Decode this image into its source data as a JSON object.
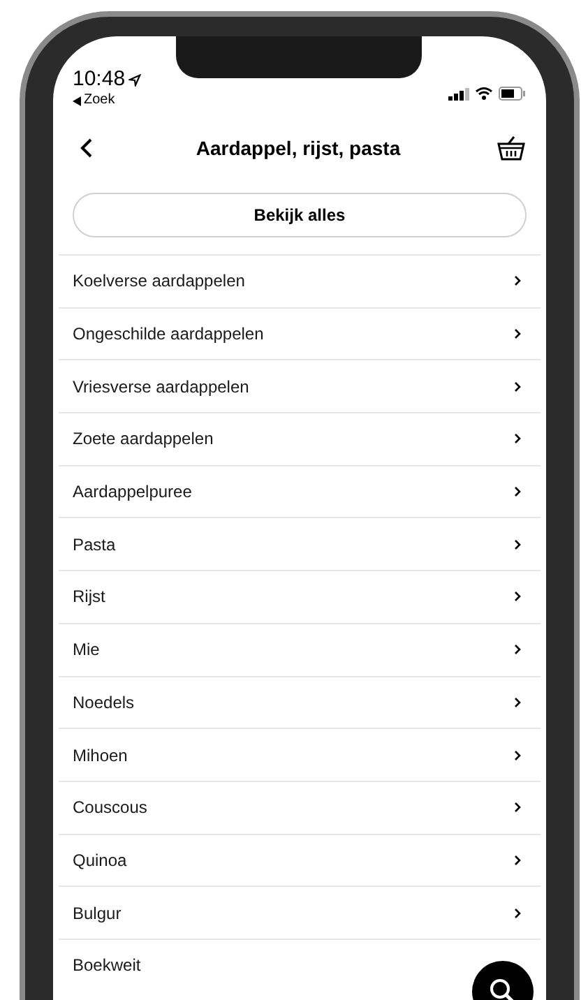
{
  "status_bar": {
    "time": "10:48",
    "back_label": "Zoek"
  },
  "header": {
    "title": "Aardappel, rijst, pasta"
  },
  "view_all_button": {
    "label": "Bekijk alles"
  },
  "categories": [
    {
      "label": "Koelverse aardappelen",
      "chevron": true
    },
    {
      "label": "Ongeschilde aardappelen",
      "chevron": true
    },
    {
      "label": "Vriesverse aardappelen",
      "chevron": true
    },
    {
      "label": "Zoete aardappelen",
      "chevron": true
    },
    {
      "label": "Aardappelpuree",
      "chevron": true
    },
    {
      "label": "Pasta",
      "chevron": true
    },
    {
      "label": "Rijst",
      "chevron": true
    },
    {
      "label": "Mie",
      "chevron": true
    },
    {
      "label": "Noedels",
      "chevron": true
    },
    {
      "label": "Mihoen",
      "chevron": true
    },
    {
      "label": "Couscous",
      "chevron": true
    },
    {
      "label": "Quinoa",
      "chevron": true
    },
    {
      "label": "Bulgur",
      "chevron": true
    },
    {
      "label": "Boekweit",
      "chevron": false
    }
  ]
}
